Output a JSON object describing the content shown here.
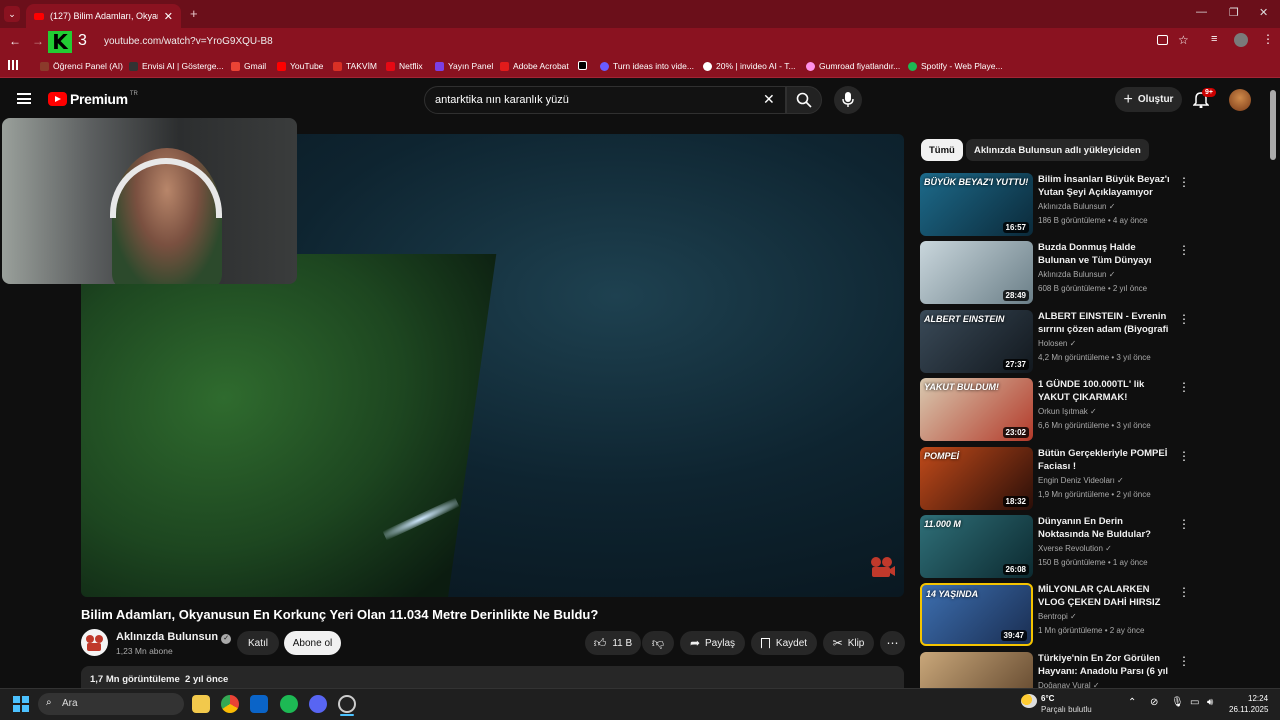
{
  "browser": {
    "tab_title": "(127) Bilim Adamları, Okyanusu...",
    "url": "youtube.com/watch?v=YroG9XQU-B8",
    "bookmarks": [
      {
        "label": "Öğrenci Panel (AI)",
        "color": "#8b3a2b"
      },
      {
        "label": "Envisi AI | Gösterge...",
        "color": "#333333"
      },
      {
        "label": "Gmail",
        "color": "#ea4335"
      },
      {
        "label": "YouTube",
        "color": "#ff0000"
      },
      {
        "label": "TAKVİM",
        "color": "#d93025"
      },
      {
        "label": "Netflix",
        "color": "#e50914"
      },
      {
        "label": "Yayın Panel",
        "color": "#7b3fe4"
      },
      {
        "label": "Adobe Acrobat",
        "color": "#e21b1b"
      },
      {
        "label": "",
        "color": "#000000"
      },
      {
        "label": "Turn ideas into vide...",
        "color": "#6a5cff"
      },
      {
        "label": "20% | invideo AI - T...",
        "color": "#ffffff"
      },
      {
        "label": "Gumroad fiyatlandır...",
        "color": "#ff90e8"
      },
      {
        "label": "Spotify - Web Playe...",
        "color": "#1db954"
      }
    ]
  },
  "youtube": {
    "logo_text": "Premium",
    "logo_region": "TR",
    "search_value": "antarktika nın karanlık yüzü",
    "create_label": "Oluştur",
    "notif_count": "9+",
    "video": {
      "title": "Bilim Adamları, Okyanusun En Korkunç Yeri Olan 11.034 Metre Derinlikte Ne Buldu?",
      "channel": "Aklınızda Bulunsun",
      "subscribers": "1,23 Mn abone",
      "join_label": "Katıl",
      "subscribe_label": "Abone ol",
      "likes": "11 B",
      "share_label": "Paylaş",
      "save_label": "Kaydet",
      "clip_label": "Klip",
      "views": "1,7 Mn görüntüleme",
      "age": "2 yıl önce"
    },
    "chips": [
      "Tümü",
      "Aklınızda Bulunsun adlı yükleyiciden"
    ],
    "recommendations": [
      {
        "title": "Bilim İnsanları Büyük Beyaz'ı Yutan Şeyi Açıklayamıyor",
        "channel": "Aklınızda Bulunsun",
        "meta": "186 B görüntüleme • 4 ay önce",
        "duration": "16:57",
        "thumb_text": "BÜYÜK BEYAZ'I YUTTU!",
        "c1": "#1d6a8a",
        "c2": "#0b2a3a"
      },
      {
        "title": "Buzda Donmuş Halde Bulunan ve Tüm Dünyayı Şaşırtan ...",
        "channel": "Aklınızda Bulunsun",
        "meta": "608 B görüntüleme • 2 yıl önce",
        "duration": "28:49",
        "thumb_text": "",
        "c1": "#c9d6dc",
        "c2": "#6b7f88"
      },
      {
        "title": "ALBERT EINSTEIN - Evrenin sırrını çözen adam (Biyografi ...",
        "channel": "Holosen",
        "meta": "4,2 Mn görüntüleme • 3 yıl önce",
        "duration": "27:37",
        "thumb_text": "ALBERT EINSTEIN",
        "c1": "#3a4a58",
        "c2": "#12181e"
      },
      {
        "title": "1 GÜNDE 100.000TL' lik YAKUT ÇIKARMAK!",
        "channel": "Orkun Işıtmak",
        "meta": "6,6 Mn görüntüleme • 3 yıl önce",
        "duration": "23:02",
        "thumb_text": "YAKUT BULDUM!",
        "c1": "#d9c9b0",
        "c2": "#b33a2a"
      },
      {
        "title": "Bütün Gerçekleriyle POMPEİ Faciası !",
        "channel": "Engin Deniz Videoları",
        "meta": "1,9 Mn görüntüleme • 2 yıl önce",
        "duration": "18:32",
        "thumb_text": "POMPEİ",
        "c1": "#c04a1a",
        "c2": "#2a0e08"
      },
      {
        "title": "Dünyanın En Derin Noktasında Ne Buldular?",
        "channel": "Xverse Revolution",
        "meta": "150 B görüntüleme • 1 ay önce",
        "duration": "26:08",
        "thumb_text": "11.000 M",
        "c1": "#2f6f78",
        "c2": "#0c2a30"
      },
      {
        "title": "MİLYONLAR ÇALARKEN VLOG ÇEKEN DAHİ HIRSIZ",
        "channel": "Bentropi",
        "meta": "1 Mn görüntüleme • 2 ay önce",
        "duration": "39:47",
        "thumb_text": "14 YAŞINDA",
        "c1": "#3d6fb0",
        "c2": "#1a2e52"
      },
      {
        "title": "Türkiye'nin En Zor Görülen Hayvanı: Anadolu Parsı (6 yıl ...",
        "channel": "Doğanay Vural",
        "meta": "",
        "duration": "",
        "thumb_text": "",
        "c1": "#c9a77a",
        "c2": "#5a4028"
      }
    ]
  },
  "taskbar": {
    "search_label": "Ara",
    "weather_temp": "6°C",
    "weather_desc": "Parçalı bulutlu",
    "time": "12:24",
    "date": "26.11.2025"
  }
}
